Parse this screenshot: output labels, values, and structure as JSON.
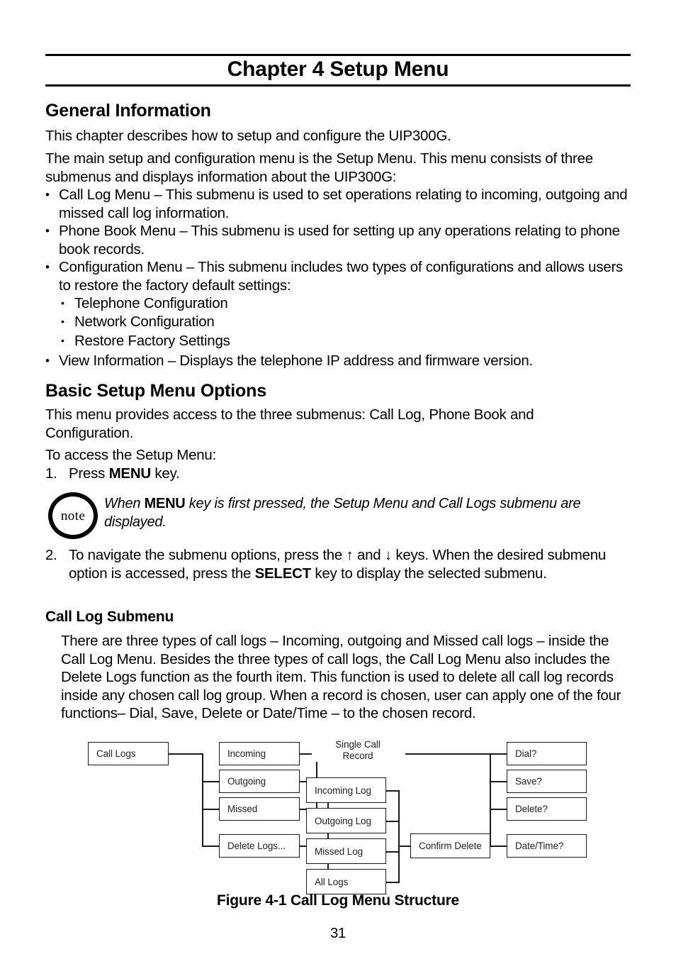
{
  "header": {
    "chapter_title": "Chapter 4 Setup Menu"
  },
  "sections": {
    "general_information": {
      "heading": "General Information",
      "p1": "This chapter describes how to setup and configure the UIP300G.",
      "p2": "The main setup and configuration menu is the Setup Menu. This menu consists of three submenus and displays information about the UIP300G:",
      "bullets": [
        "Call Log Menu – This submenu is used to set operations relating to incoming, outgoing and missed call log information.",
        "Phone Book Menu – This submenu is used for setting up any operations relating to phone book records.",
        "Configuration Menu – This submenu includes two types of configurations and allows users to restore the factory default settings:"
      ],
      "sub_bullets": [
        "Telephone Configuration",
        "Network Configuration",
        "Restore Factory Settings"
      ],
      "last_bullet": "View Information – Displays the telephone IP address and firmware version."
    },
    "basic_setup": {
      "heading": "Basic Setup Menu Options",
      "p1": "This menu provides access to the three submenus: Call Log, Phone Book and Configuration.",
      "p2": "To access the Setup Menu:",
      "step1_num": "1.",
      "step1_pre": "Press ",
      "step1_bold": "MENU",
      "step1_post": " key.",
      "note_badge_label": "note",
      "note_pre": "When ",
      "note_bold": "MENU",
      "note_post": " key is first pressed, the Setup Menu and Call Logs submenu are displayed.",
      "step2_num": "2.",
      "step2_part1": "To navigate the submenu options, press the ↑ and ↓ keys. When the desired submenu option is accessed, press the ",
      "step2_bold": "SELECT",
      "step2_part2": " key to display the selected submenu."
    },
    "call_log_submenu": {
      "heading": "Call Log Submenu",
      "p1": "There are three types of call logs – Incoming, outgoing and Missed call logs – inside the Call Log Menu. Besides the three types of call logs, the Call Log Menu also includes the Delete Logs function as the fourth item. This function is used to delete all call log records inside any chosen call log group. When a record is chosen, user can apply one of the four functions– Dial, Save, Delete or Date/Time – to the chosen record."
    }
  },
  "diagram": {
    "root": "Call Logs",
    "column1": [
      "Incoming",
      "Outgoing",
      "Missed",
      "Delete Logs..."
    ],
    "connector_label_line1": "Single Call",
    "connector_label_line2": "Record",
    "column2": [
      "Incoming Log",
      "Outgoing Log",
      "Missed Log",
      "All Logs"
    ],
    "confirm": "Confirm Delete",
    "column3": [
      "Dial?",
      "Save?",
      "Delete?",
      "Date/Time?"
    ]
  },
  "figure_caption": "Figure 4-1 Call Log Menu Structure",
  "page_number": "31"
}
